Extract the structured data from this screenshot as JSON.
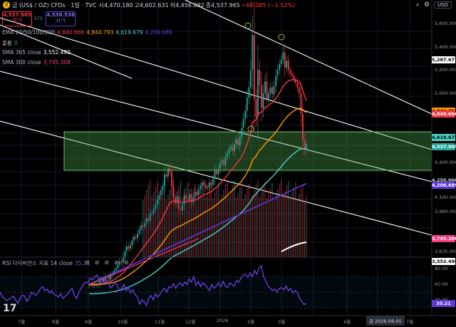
{
  "header": {
    "icon_label": "금",
    "title": "금 (US$ / OZ) CFDs · 1일 · TVC",
    "ohlc": [
      {
        "k": "시",
        "v": "4,470.180",
        "c": "#d1d4dc"
      },
      {
        "k": "고",
        "v": "4,602.631",
        "c": "#d1d4dc"
      },
      {
        "k": "저",
        "v": "4,456.092",
        "c": "#d1d4dc"
      },
      {
        "k": "종",
        "v": "4,537.965",
        "c": "#d1d4dc"
      },
      {
        "k": "",
        "v": "−68.085 (−1.52%)",
        "c": "#f23645"
      }
    ],
    "sell": {
      "price": "4,537.965",
      "label": "팔기"
    },
    "spread": "573",
    "buy": {
      "price": "4,538.538",
      "label": "사기"
    }
  },
  "indicators": [
    {
      "name": "EMA 20/50/100/200",
      "values": [
        {
          "v": "4,840.666",
          "c": "#f23645"
        },
        {
          "v": "4,844.793",
          "c": "#ff9800"
        },
        {
          "v": "4,619.679",
          "c": "#4dd0c4"
        },
        {
          "v": "4,206.689",
          "c": "#5b3ad6"
        }
      ]
    },
    {
      "name": "볼륨",
      "values": [
        {
          "v": "0",
          "c": "#26a69a"
        }
      ]
    },
    {
      "name": "SMA 365 close",
      "values": [
        {
          "v": "3,552.490",
          "c": "#ffffff"
        }
      ]
    },
    {
      "name": "SMA 300 close",
      "values": [
        {
          "v": "3,745.308",
          "c": "#f23a7e"
        }
      ]
    }
  ],
  "top_right": {
    "currency": "USD"
  },
  "rsi": {
    "label": "RSI 다이버전스 지표 14 close",
    "value": "35.21",
    "ticks": [
      "80.00",
      "60.00",
      "40.00"
    ],
    "tag": "35.21",
    "values": [
      50,
      44,
      42,
      39,
      41,
      43,
      45,
      40,
      36,
      43,
      46,
      45,
      38,
      43,
      50,
      48,
      46,
      50,
      55,
      57,
      52,
      54,
      49,
      52,
      47,
      46,
      44,
      48,
      42,
      45,
      48,
      52,
      55,
      46,
      42,
      50,
      55,
      60,
      63,
      62,
      68,
      66,
      70,
      72,
      65,
      69,
      60,
      66,
      64,
      56,
      58,
      63,
      59,
      52,
      55,
      60,
      52,
      56,
      49,
      53,
      47,
      44,
      35,
      40,
      38,
      33,
      42,
      46,
      40,
      48,
      44,
      47,
      52,
      55,
      50,
      57,
      56,
      61,
      55,
      60,
      62,
      58,
      63,
      60,
      67,
      63,
      70,
      59,
      64,
      57,
      62,
      60,
      56,
      52,
      60,
      55,
      58,
      62,
      57,
      64,
      58,
      56,
      62,
      60,
      58,
      65,
      63,
      68,
      72,
      73,
      69,
      75,
      70,
      78,
      73,
      81,
      84,
      70,
      64,
      58,
      55,
      52,
      54,
      50,
      55,
      56,
      53,
      58,
      52,
      55,
      49,
      52,
      50,
      42,
      38,
      34,
      36
    ]
  },
  "price_axis": {
    "ticks": [
      "5,600.000",
      "5,400.000",
      "5,200.000",
      "5,000.000",
      "4,400.000",
      "4,100.000",
      "3,980.000",
      "3,635.000"
    ],
    "tags": [
      {
        "v": "5,287.677",
        "bg": "#ffffff",
        "fg": "#000000",
        "py": 5287
      },
      {
        "v": "4,844.793",
        "bg": "#ff9800",
        "fg": "#000000",
        "py": 4845
      },
      {
        "v": "4,840.666",
        "bg": "#f23645",
        "fg": "#ffffff",
        "py": 4820
      },
      {
        "v": "4,619.679",
        "bg": "#4dd0c4",
        "fg": "#000000",
        "py": 4620
      },
      {
        "v": "4,537.965",
        "bg": "#26a69a",
        "fg": "#ffffff",
        "py": 4538
      },
      {
        "v": "4,250.000",
        "bg": "#000000",
        "fg": "#d1d4dc",
        "py": 4250
      },
      {
        "v": "4,206.689",
        "bg": "#5b3ad6",
        "fg": "#ffffff",
        "py": 4207
      },
      {
        "v": "3,745.308",
        "bg": "#f23a7e",
        "fg": "#ffffff",
        "py": 3745
      },
      {
        "v": "3,552.490",
        "bg": "#ffffff",
        "fg": "#000000",
        "py": 3552
      }
    ]
  },
  "x_axis": [
    "7월",
    "8월",
    "9월",
    "10월",
    "11월",
    "12월",
    "2026",
    "2월",
    "3월",
    "4월",
    "5월",
    "7월"
  ],
  "date_tag": "금 2026-06-05",
  "controls": [
    "⊘",
    "⊘",
    "⊘",
    "⊘",
    "⊘"
  ],
  "close_prices": [
    3350,
    3345,
    3340,
    3360,
    3345,
    3355,
    3390,
    3400,
    3380,
    3415,
    3420,
    3395,
    3430,
    3445,
    3470,
    3490,
    3520,
    3550,
    3540,
    3590,
    3640,
    3680,
    3660,
    3690,
    3730,
    3760,
    3750,
    3790,
    3820,
    3860,
    3850,
    3880,
    3920,
    3900,
    3960,
    3970,
    4000,
    4040,
    4080,
    4120,
    4160,
    4200,
    4300,
    4280,
    4350,
    4320,
    4200,
    4100,
    4050,
    4110,
    4000,
    3990,
    4040,
    4120,
    4090,
    4080,
    4130,
    4060,
    4100,
    4150,
    4120,
    4170,
    4200,
    4230,
    4210,
    4180,
    4190,
    4230,
    4210,
    4260,
    4330,
    4300,
    4350,
    4400,
    4420,
    4380,
    4450,
    4480,
    4520,
    4540,
    4500,
    4560,
    4600,
    4550,
    4620,
    4700,
    4780,
    4850,
    4960,
    5050,
    5200,
    5500,
    4950,
    4800,
    5200,
    5070,
    4870,
    5000,
    5100,
    4950,
    5000,
    5050,
    4990,
    5060,
    5150,
    5200,
    5250,
    5290,
    5350,
    5220,
    5280,
    5200,
    5170,
    5150,
    5120,
    5090,
    5050,
    5000,
    4820,
    4590,
    4510,
    4560
  ]
}
